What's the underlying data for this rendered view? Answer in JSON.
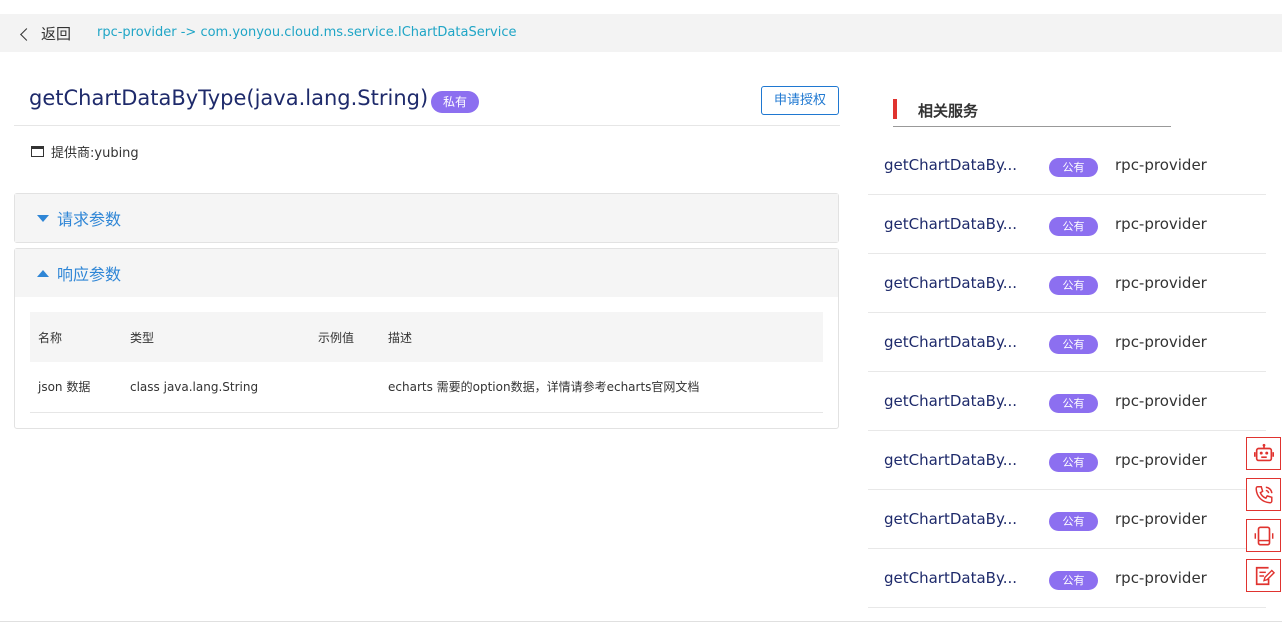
{
  "topbar": {
    "back_label": "返回",
    "breadcrumb": "rpc-provider -> com.yonyou.cloud.ms.service.IChartDataService"
  },
  "method": {
    "title": "getChartDataByType(java.lang.String)",
    "visibility_badge": "私有",
    "apply_button": "申请授权",
    "provider_label": "提供商:yubing"
  },
  "request_panel": {
    "title": "请求参数"
  },
  "response_panel": {
    "title": "响应参数",
    "columns": [
      "名称",
      "类型",
      "示例值",
      "描述"
    ],
    "rows": [
      {
        "name": "json 数据",
        "type": "class java.lang.String",
        "example": "",
        "desc": "echarts 需要的option数据，详情请参考echarts官网文档"
      }
    ]
  },
  "related": {
    "title": "相关服务",
    "items": [
      {
        "name": "getChartDataBy...",
        "badge": "公有",
        "provider": "rpc-provider"
      },
      {
        "name": "getChartDataBy...",
        "badge": "公有",
        "provider": "rpc-provider"
      },
      {
        "name": "getChartDataBy...",
        "badge": "公有",
        "provider": "rpc-provider"
      },
      {
        "name": "getChartDataBy...",
        "badge": "公有",
        "provider": "rpc-provider"
      },
      {
        "name": "getChartDataBy...",
        "badge": "公有",
        "provider": "rpc-provider"
      },
      {
        "name": "getChartDataBy...",
        "badge": "公有",
        "provider": "rpc-provider"
      },
      {
        "name": "getChartDataBy...",
        "badge": "公有",
        "provider": "rpc-provider"
      },
      {
        "name": "getChartDataBy...",
        "badge": "公有",
        "provider": "rpc-provider"
      }
    ]
  },
  "floating_tools": [
    {
      "icon": "robot-icon"
    },
    {
      "icon": "phone-icon"
    },
    {
      "icon": "mobile-icon"
    },
    {
      "icon": "note-edit-icon"
    }
  ],
  "colors": {
    "accent_blue": "#2f86d6",
    "title_navy": "#1e2a6b",
    "badge_purple": "#8c6ff0",
    "tool_red": "#e0332f",
    "breadcrumb_teal": "#1fa5c6"
  }
}
